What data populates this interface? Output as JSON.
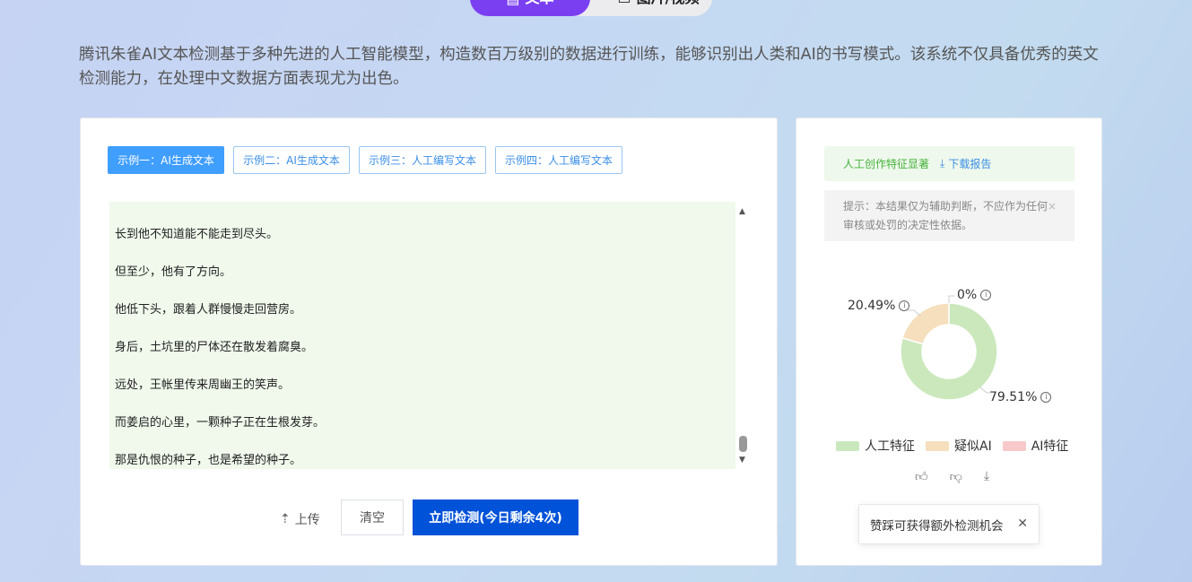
{
  "mode_tabs": [
    {
      "label": "文本",
      "icon": "document-icon"
    },
    {
      "label": "图片/视频",
      "icon": "image-icon"
    }
  ],
  "description": "腾讯朱雀AI文本检测基于多种先进的人工智能模型，构造数百万级别的数据进行训练，能够识别出人类和AI的书写模式。该系统不仅具备优秀的英文检测能力，在处理中文数据方面表现尤为出色。",
  "examples": [
    {
      "label": "示例一：AI生成文本"
    },
    {
      "label": "示例二：AI生成文本"
    },
    {
      "label": "示例三：人工编写文本"
    },
    {
      "label": "示例四：人工编写文本"
    }
  ],
  "text_lines": [
    "长到他不知道能不能走到尽头。",
    "但至少，他有了方向。",
    "他低下头，跟着人群慢慢走回营房。",
    "身后，土坑里的尸体还在散发着腐臭。",
    "远处，王帐里传来周幽王的笑声。",
    "而姜启的心里，一颗种子正在生根发芽。",
    "那是仇恨的种子，也是希望的种子。"
  ],
  "actions": {
    "upload": "上传",
    "clear": "清空",
    "detect": "立即检测(今日剩余4次)"
  },
  "result": {
    "label": "人工创作特征显著",
    "download": "下载报告",
    "hint": "提示：本结果仅为辅助判断，不应作为任何审核或处罚的决定性依据。"
  },
  "chart_data": {
    "type": "pie",
    "donut": true,
    "series": [
      {
        "name": "人工特征",
        "value": 79.51,
        "label": "79.51%",
        "color": "#cbe8bd"
      },
      {
        "name": "疑似AI",
        "value": 20.49,
        "label": "20.49%",
        "color": "#f5dfbd"
      },
      {
        "name": "AI特征",
        "value": 0,
        "label": "0%",
        "color": "#f7c9cb"
      }
    ]
  },
  "toast": "赞踩可获得额外检测机会"
}
